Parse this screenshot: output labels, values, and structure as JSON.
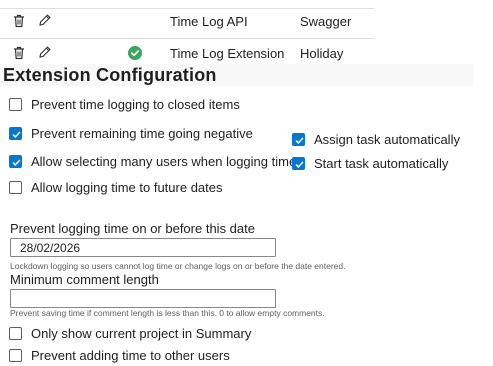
{
  "table": {
    "rows": [
      {
        "name": "Time Log API",
        "type": "Swagger",
        "enabled": false
      },
      {
        "name": "Time Log Extension",
        "type": "Holiday",
        "enabled": true
      }
    ]
  },
  "icons": {
    "delete": "trash-icon",
    "edit": "pencil-icon",
    "enabled": "check-circle-icon"
  },
  "colors": {
    "accent": "#0078d4",
    "enabled_green": "#3aa55c"
  },
  "section": {
    "title": "Extension Configuration"
  },
  "options_left": [
    {
      "label": "Prevent time logging to closed items",
      "checked": false
    },
    {
      "label": "Prevent remaining time going negative",
      "checked": true
    },
    {
      "label": "Allow selecting many users when logging time",
      "checked": true
    },
    {
      "label": "Allow logging time to future dates",
      "checked": false
    }
  ],
  "options_right": [
    {
      "label": "Assign task automatically",
      "checked": true
    },
    {
      "label": "Start task automatically",
      "checked": true
    }
  ],
  "lockdown": {
    "label": "Prevent logging time on or before this date",
    "value": "28/02/2026",
    "hint": "Lockdown logging so users cannot log time or change logs on or before the date entered."
  },
  "min_comment": {
    "label": "Minimum comment length",
    "value": "",
    "hint": "Prevent saving time if comment length is less than this. 0 to allow empty comments."
  },
  "options_bottom": [
    {
      "label": "Only show current project in Summary",
      "checked": false
    },
    {
      "label": "Prevent adding time to other users",
      "checked": false
    }
  ]
}
